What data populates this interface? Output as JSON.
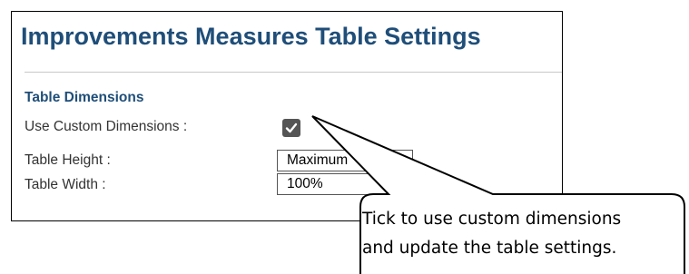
{
  "panel": {
    "title": "Improvements Measures Table Settings",
    "section_title": "Table Dimensions",
    "custom_dimensions": {
      "label": "Use Custom Dimensions :",
      "checked": true
    },
    "table_height": {
      "label": "Table Height :",
      "value": "Maximum"
    },
    "table_width": {
      "label": "Table Width :",
      "value": "100%"
    }
  },
  "callout": {
    "line1": "Tick to use custom dimensions",
    "line2": "and update the table settings."
  },
  "colors": {
    "heading": "#1f4e79",
    "checkbox": "#555555",
    "border": "#000000"
  }
}
